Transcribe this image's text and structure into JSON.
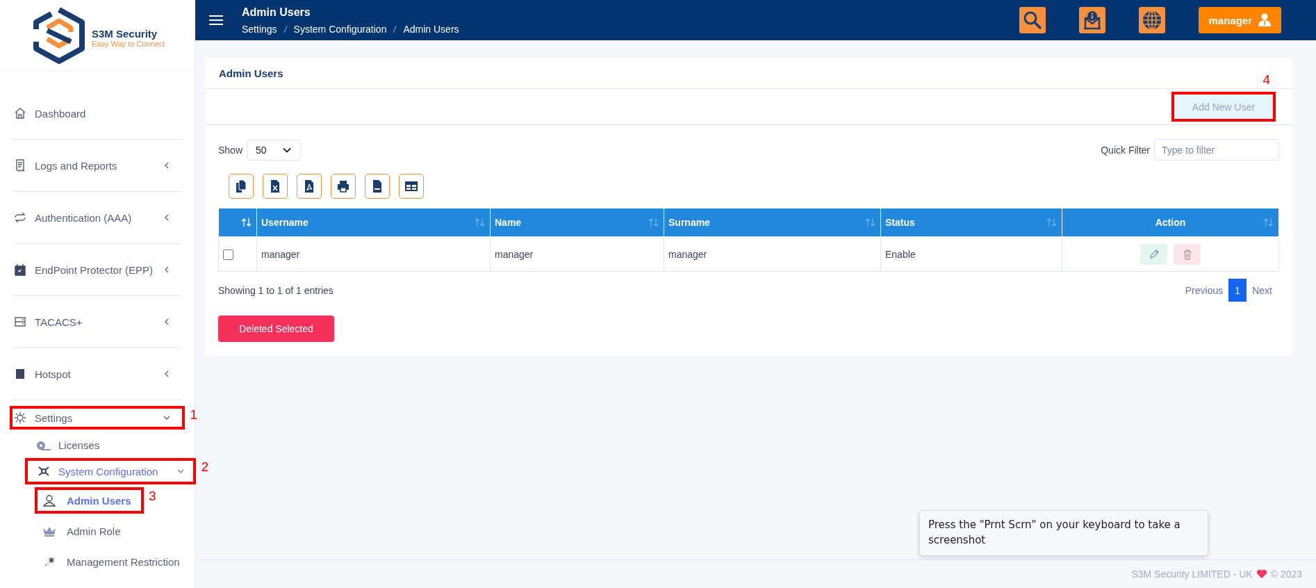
{
  "brand": {
    "name": "S3M Security",
    "tagline": "Easy Way to Connect"
  },
  "header": {
    "title": "Admin Users",
    "breadcrumb": [
      "Settings",
      "System Configuration",
      "Admin Users"
    ],
    "user": "manager"
  },
  "sidebar": {
    "items": [
      {
        "label": "Dashboard",
        "selected": false
      },
      {
        "label": "Logs and Reports",
        "expanded": false,
        "selected": false
      },
      {
        "label": "Authentication (AAA)",
        "expanded": false,
        "selected": false
      },
      {
        "label": "EndPoint Protector (EPP)",
        "expanded": false,
        "selected": false
      },
      {
        "label": "TACACS+",
        "expanded": false,
        "selected": false
      },
      {
        "label": "Hotspot",
        "expanded": false,
        "selected": false
      },
      {
        "label": "Settings",
        "expanded": true,
        "selected": false,
        "callout": "1",
        "children": [
          {
            "label": "Licenses",
            "selected": false
          },
          {
            "label": "System Configuration",
            "expanded": true,
            "selected": false,
            "callout": "2",
            "children": [
              {
                "label": "Admin Users",
                "selected": true,
                "callout": "3"
              },
              {
                "label": "Admin Role",
                "selected": false
              },
              {
                "label": "Management Restriction",
                "selected": false
              }
            ]
          }
        ]
      }
    ]
  },
  "card": {
    "title": "Admin Users",
    "add_button": {
      "label": "Add New User",
      "disabled": true,
      "callout": "4"
    },
    "show_label": "Show",
    "page_size": "50",
    "filter_label": "Quick Filter",
    "filter": {
      "placeholder": "Type to filter"
    },
    "columns": [
      {
        "label": "Username"
      },
      {
        "label": "Name"
      },
      {
        "label": "Surname"
      },
      {
        "label": "Status"
      },
      {
        "label": "Action"
      }
    ],
    "rows": [
      {
        "checked": false,
        "cells": [
          "manager",
          "manager",
          "manager",
          "Enable"
        ]
      }
    ],
    "info": "Showing 1 to 1 of 1 entries",
    "pagination": {
      "previous": "Previous",
      "pages": [
        {
          "label": "1",
          "selected": true
        }
      ],
      "next": "Next"
    },
    "delete_button": "Deleted Selected"
  },
  "footer": {
    "company": "S3M Security LIMITED - UK",
    "copyright": "© 2023"
  },
  "tooltip": "Press the \"Prnt Scrn\" on your keyboard to take a screenshot"
}
